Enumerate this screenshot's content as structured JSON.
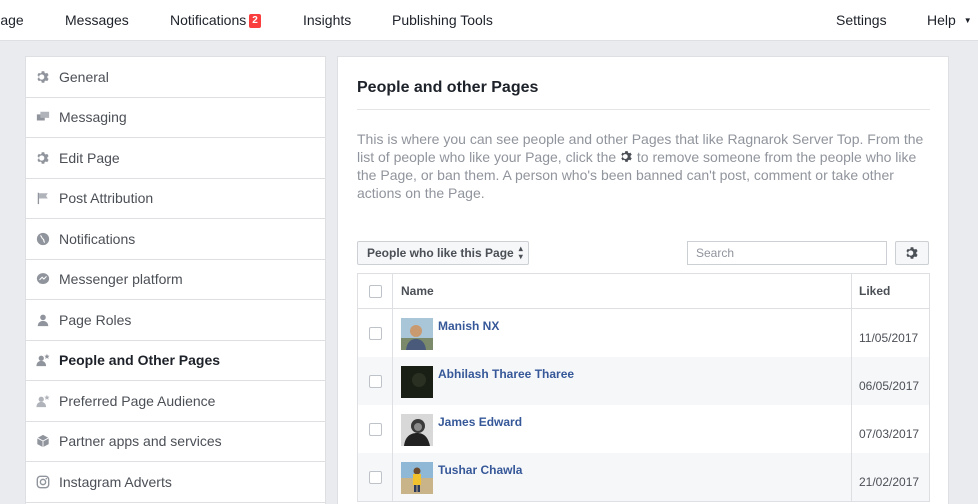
{
  "nav": {
    "page_label": "Page",
    "messages": "Messages",
    "notifications": "Notifications",
    "notifications_count": "2",
    "insights": "Insights",
    "publishing_tools": "Publishing Tools",
    "settings": "Settings",
    "help": "Help"
  },
  "sidebar": {
    "items": [
      {
        "label": "General",
        "icon": "gear-icon"
      },
      {
        "label": "Messaging",
        "icon": "chat-bubbles-icon"
      },
      {
        "label": "Edit Page",
        "icon": "gear-icon"
      },
      {
        "label": "Post Attribution",
        "icon": "flag-icon"
      },
      {
        "label": "Notifications",
        "icon": "globe-icon"
      },
      {
        "label": "Messenger platform",
        "icon": "messenger-icon"
      },
      {
        "label": "Page Roles",
        "icon": "person-icon"
      },
      {
        "label": "People and Other Pages",
        "icon": "person-star-icon"
      },
      {
        "label": "Preferred Page Audience",
        "icon": "person-star-icon"
      },
      {
        "label": "Partner apps and services",
        "icon": "cube-icon"
      },
      {
        "label": "Instagram Adverts",
        "icon": "instagram-icon"
      }
    ]
  },
  "main": {
    "title": "People and other Pages",
    "desc_part1": "This is where you can see people and other Pages that like Ragnarok Server Top. From the list of people who like your Page, click the",
    "desc_part2": "to remove someone from the people who like the Page, or ban them. A person who's been banned can't post, comment or take other actions on the Page.",
    "filter_label": "People who like this Page",
    "search_placeholder": "Search",
    "table": {
      "headers": {
        "name": "Name",
        "liked": "Liked"
      },
      "rows": [
        {
          "name": "Manish NX",
          "liked": "11/05/2017"
        },
        {
          "name": "Abhilash Tharee Tharee",
          "liked": "06/05/2017"
        },
        {
          "name": "James Edward",
          "liked": "07/03/2017"
        },
        {
          "name": "Tushar Chawla",
          "liked": "21/02/2017"
        }
      ]
    }
  },
  "colors": {
    "link": "#365899",
    "badge": "#fa3e3e",
    "muted": "#90949c",
    "background": "#e9ebee"
  }
}
